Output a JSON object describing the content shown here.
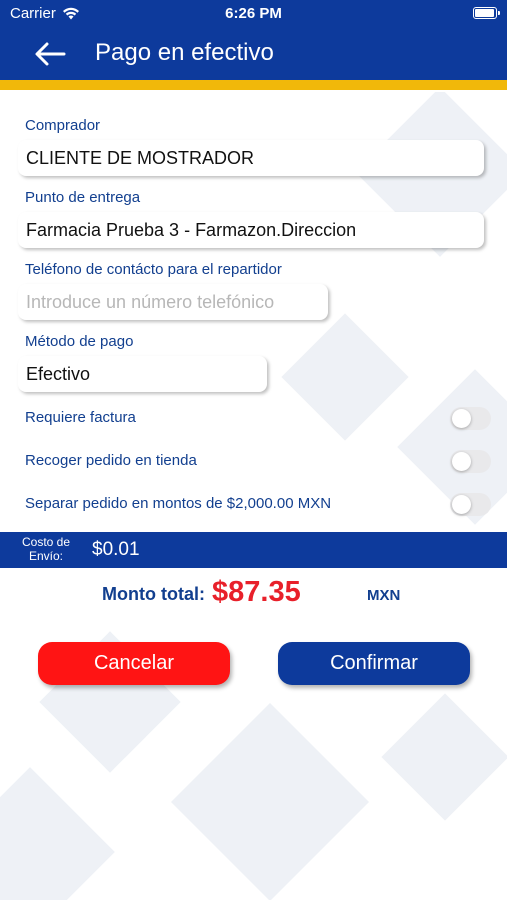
{
  "status_bar": {
    "carrier": "Carrier",
    "time": "6:26 PM",
    "battery_level": 1.0
  },
  "header": {
    "back_icon": "arrow-left-icon",
    "title": "Pago en efectivo"
  },
  "colors": {
    "primary": "#0d3a9c",
    "accent": "#f1b80a",
    "danger": "#ff1414",
    "total_value": "#e8202a",
    "label": "#123f8f"
  },
  "form": {
    "buyer": {
      "label": "Comprador",
      "value": "CLIENTE DE MOSTRADOR"
    },
    "delivery": {
      "label": "Punto de entrega",
      "value": "Farmacia Prueba 3 - Farmazon.Direccion"
    },
    "phone": {
      "label": "Teléfono de contácto para el repartidor",
      "value": "",
      "placeholder": "Introduce un número telefónico"
    },
    "payment": {
      "label": "Método de pago",
      "value": "Efectivo"
    }
  },
  "toggles": [
    {
      "label": "Requiere factura",
      "on": false
    },
    {
      "label": "Recoger pedido en tienda",
      "on": false
    },
    {
      "label": "Separar pedido en montos de $2,000.00 MXN",
      "on": false
    }
  ],
  "shipping": {
    "label": "Costo de Envío:",
    "value": "$0.01"
  },
  "total": {
    "label": "Monto total:",
    "value": "$87.35",
    "currency": "MXN"
  },
  "buttons": {
    "cancel": "Cancelar",
    "confirm": "Confirmar"
  }
}
